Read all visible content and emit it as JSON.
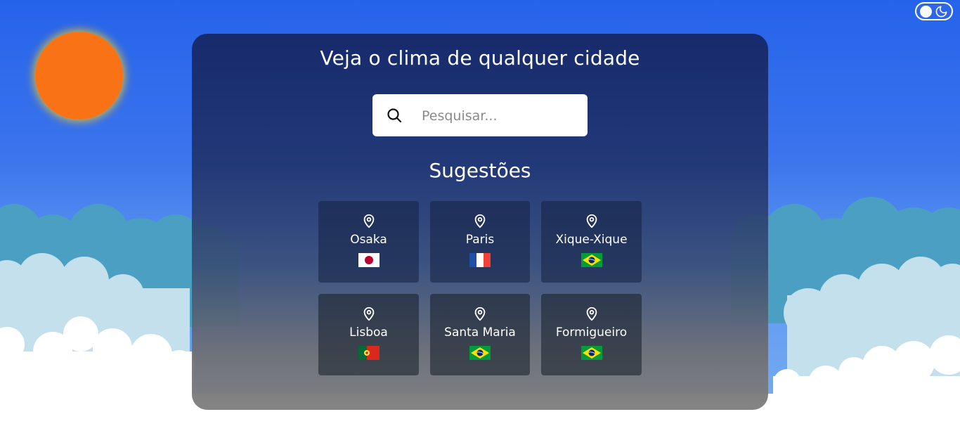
{
  "app": {
    "title": "Veja o clima de qualquer cidade",
    "accent": "#2563eb",
    "sun_color": "#f97316"
  },
  "toggle": {
    "mode": "light",
    "icon": "moon-icon"
  },
  "search": {
    "placeholder": "Pesquisar...",
    "value": "",
    "icon": "search-icon"
  },
  "suggestions": {
    "title": "Sugestões",
    "cities": [
      {
        "name": "Osaka",
        "flag": "japan"
      },
      {
        "name": "Paris",
        "flag": "france"
      },
      {
        "name": "Xique-Xique",
        "flag": "brazil"
      },
      {
        "name": "Lisboa",
        "flag": "portugal"
      },
      {
        "name": "Santa Maria",
        "flag": "brazil"
      },
      {
        "name": "Formigueiro",
        "flag": "brazil"
      }
    ]
  }
}
